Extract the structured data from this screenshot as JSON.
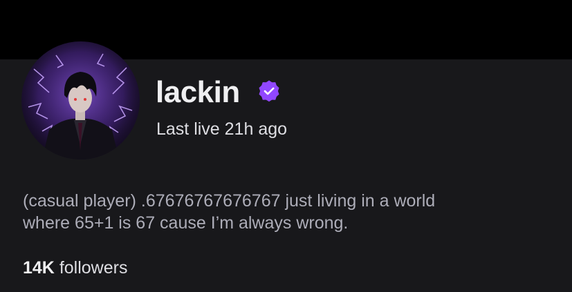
{
  "channel": {
    "name": "lackin",
    "verified": true,
    "status": "Last live 21h ago"
  },
  "bio": {
    "line1": "(casual player) .67676767676767 just living in a world",
    "line2": "where 65+1 is 67 cause I’m always wrong."
  },
  "stats": {
    "followers_count": "14K",
    "followers_label": " followers"
  },
  "icons": {
    "verified": "verified-badge-icon",
    "avatar": "avatar-image"
  },
  "colors": {
    "background": "#18181b",
    "top_bar": "#000000",
    "accent": "#9147ff",
    "text_primary": "#efeff1",
    "text_secondary": "#adadb8"
  }
}
